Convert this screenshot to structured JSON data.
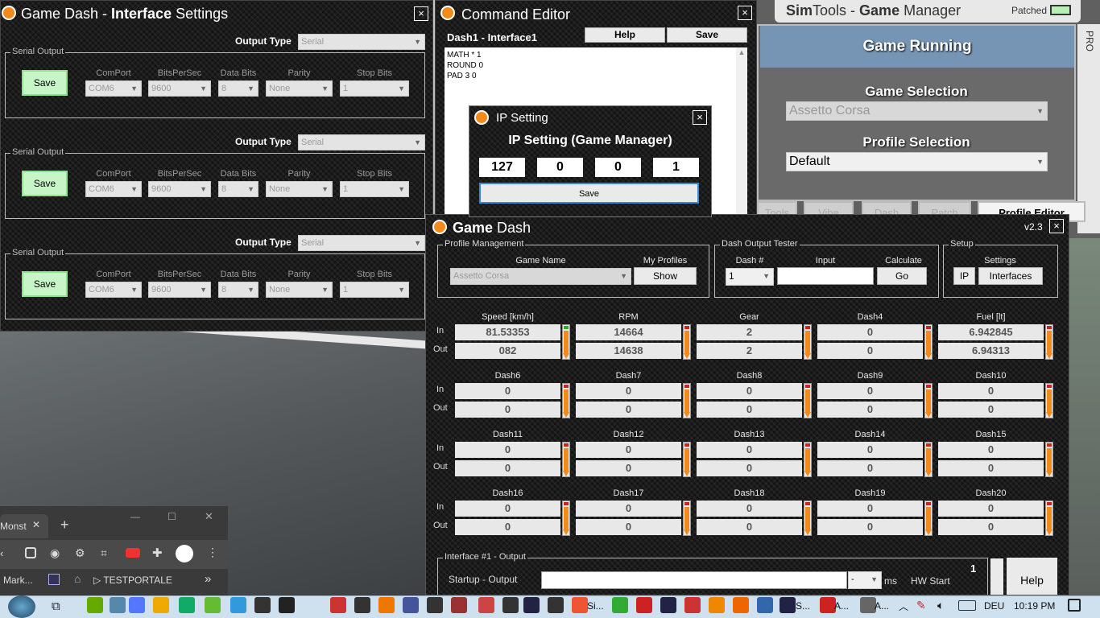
{
  "interface_settings": {
    "title_prefix": "Game Dash - ",
    "title_bold": "Interface",
    "title_suffix": " Settings",
    "close": "×",
    "rows": [
      {
        "output_type_label": "Output Type",
        "output_type_value": "Serial",
        "legend": "Serial Output",
        "save": "Save",
        "comport_label": "ComPort",
        "comport": "COM6",
        "bps_label": "BitsPerSec",
        "bps": "9600",
        "databits_label": "Data Bits",
        "databits": "8",
        "parity_label": "Parity",
        "parity": "None",
        "stopbits_label": "Stop Bits",
        "stopbits": "1"
      },
      {
        "output_type_label": "Output Type",
        "output_type_value": "Serial",
        "legend": "Serial Output",
        "save": "Save",
        "comport_label": "ComPort",
        "comport": "COM6",
        "bps_label": "BitsPerSec",
        "bps": "9600",
        "databits_label": "Data Bits",
        "databits": "8",
        "parity_label": "Parity",
        "parity": "None",
        "stopbits_label": "Stop Bits",
        "stopbits": "1"
      },
      {
        "output_type_label": "Output Type",
        "output_type_value": "Serial",
        "legend": "Serial Output",
        "save": "Save",
        "comport_label": "ComPort",
        "comport": "COM6",
        "bps_label": "BitsPerSec",
        "bps": "9600",
        "databits_label": "Data Bits",
        "databits": "8",
        "parity_label": "Parity",
        "parity": "None",
        "stopbits_label": "Stop Bits",
        "stopbits": "1"
      }
    ]
  },
  "command_editor": {
    "title": "Command Editor",
    "close": "×",
    "subtitle": "Dash1 - Interface1",
    "help": "Help",
    "save": "Save",
    "lines": [
      "MATH * 1",
      "ROUND 0",
      "PAD 3 0"
    ]
  },
  "ip_setting": {
    "title": "IP Setting",
    "close": "×",
    "heading": "IP Setting (Game Manager)",
    "octets": [
      "127",
      "0",
      "0",
      "1"
    ],
    "save": "Save"
  },
  "game_manager": {
    "title_prefix": "Sim",
    "title_mid": "Tools - ",
    "title_bold": "Game",
    "title_suffix": " Manager",
    "patched": "Patched",
    "status": "Game Running",
    "pro": "PRO",
    "game_selection_label": "Game Selection",
    "game_selection": "Assetto Corsa",
    "profile_selection_label": "Profile Selection",
    "profile_selection": "Default",
    "tabs": [
      "Tools",
      "Vibe",
      "Dash",
      "Patch",
      "Profile Editor"
    ]
  },
  "game_dash": {
    "title_bold": "Game",
    "title_rest": " Dash",
    "version": "v2.3",
    "close": "×",
    "profile_mgmt": {
      "legend": "Profile Management",
      "game_name_label": "Game Name",
      "game_name": "Assetto Corsa",
      "my_profiles_label": "My Profiles",
      "show": "Show"
    },
    "tester": {
      "legend": "Dash Output Tester",
      "dash_label": "Dash #",
      "dash_value": "1",
      "input_label": "Input",
      "calculate_label": "Calculate",
      "go": "Go"
    },
    "setup": {
      "legend": "Setup",
      "settings_label": "Settings",
      "ip": "IP",
      "interfaces": "Interfaces"
    },
    "in_label": "In",
    "out_label": "Out",
    "channels": [
      [
        {
          "name": "Speed [km/h]",
          "in": "81.53353",
          "out": "082"
        },
        {
          "name": "RPM",
          "in": "14664",
          "out": "14638"
        },
        {
          "name": "Gear",
          "in": "2",
          "out": "2"
        },
        {
          "name": "Dash4",
          "in": "0",
          "out": "0"
        },
        {
          "name": "Fuel [lt]",
          "in": "6.942845",
          "out": "6.94313"
        }
      ],
      [
        {
          "name": "Dash6",
          "in": "0",
          "out": "0"
        },
        {
          "name": "Dash7",
          "in": "0",
          "out": "0"
        },
        {
          "name": "Dash8",
          "in": "0",
          "out": "0"
        },
        {
          "name": "Dash9",
          "in": "0",
          "out": "0"
        },
        {
          "name": "Dash10",
          "in": "0",
          "out": "0"
        }
      ],
      [
        {
          "name": "Dash11",
          "in": "0",
          "out": "0"
        },
        {
          "name": "Dash12",
          "in": "0",
          "out": "0"
        },
        {
          "name": "Dash13",
          "in": "0",
          "out": "0"
        },
        {
          "name": "Dash14",
          "in": "0",
          "out": "0"
        },
        {
          "name": "Dash15",
          "in": "0",
          "out": "0"
        }
      ],
      [
        {
          "name": "Dash16",
          "in": "0",
          "out": "0"
        },
        {
          "name": "Dash17",
          "in": "0",
          "out": "0"
        },
        {
          "name": "Dash18",
          "in": "0",
          "out": "0"
        },
        {
          "name": "Dash19",
          "in": "0",
          "out": "0"
        },
        {
          "name": "Dash20",
          "in": "0",
          "out": "0"
        }
      ]
    ],
    "interface_output": {
      "legend": "Interface #1 - Output",
      "startup_label": "Startup - Output",
      "ms_select": "-",
      "ms": "ms",
      "hw_start": "HW Start",
      "number": "1",
      "help": "Help"
    }
  },
  "browser": {
    "tab_text": "Monst",
    "new_tab": "+",
    "bookmarks": [
      "Mark...",
      "▷ TESTPORTALE"
    ],
    "more": "»"
  },
  "taskbar": {
    "apps": [
      "Si...",
      "S...",
      "A...",
      "A..."
    ],
    "language": "DEU",
    "time": "10:19 PM"
  }
}
